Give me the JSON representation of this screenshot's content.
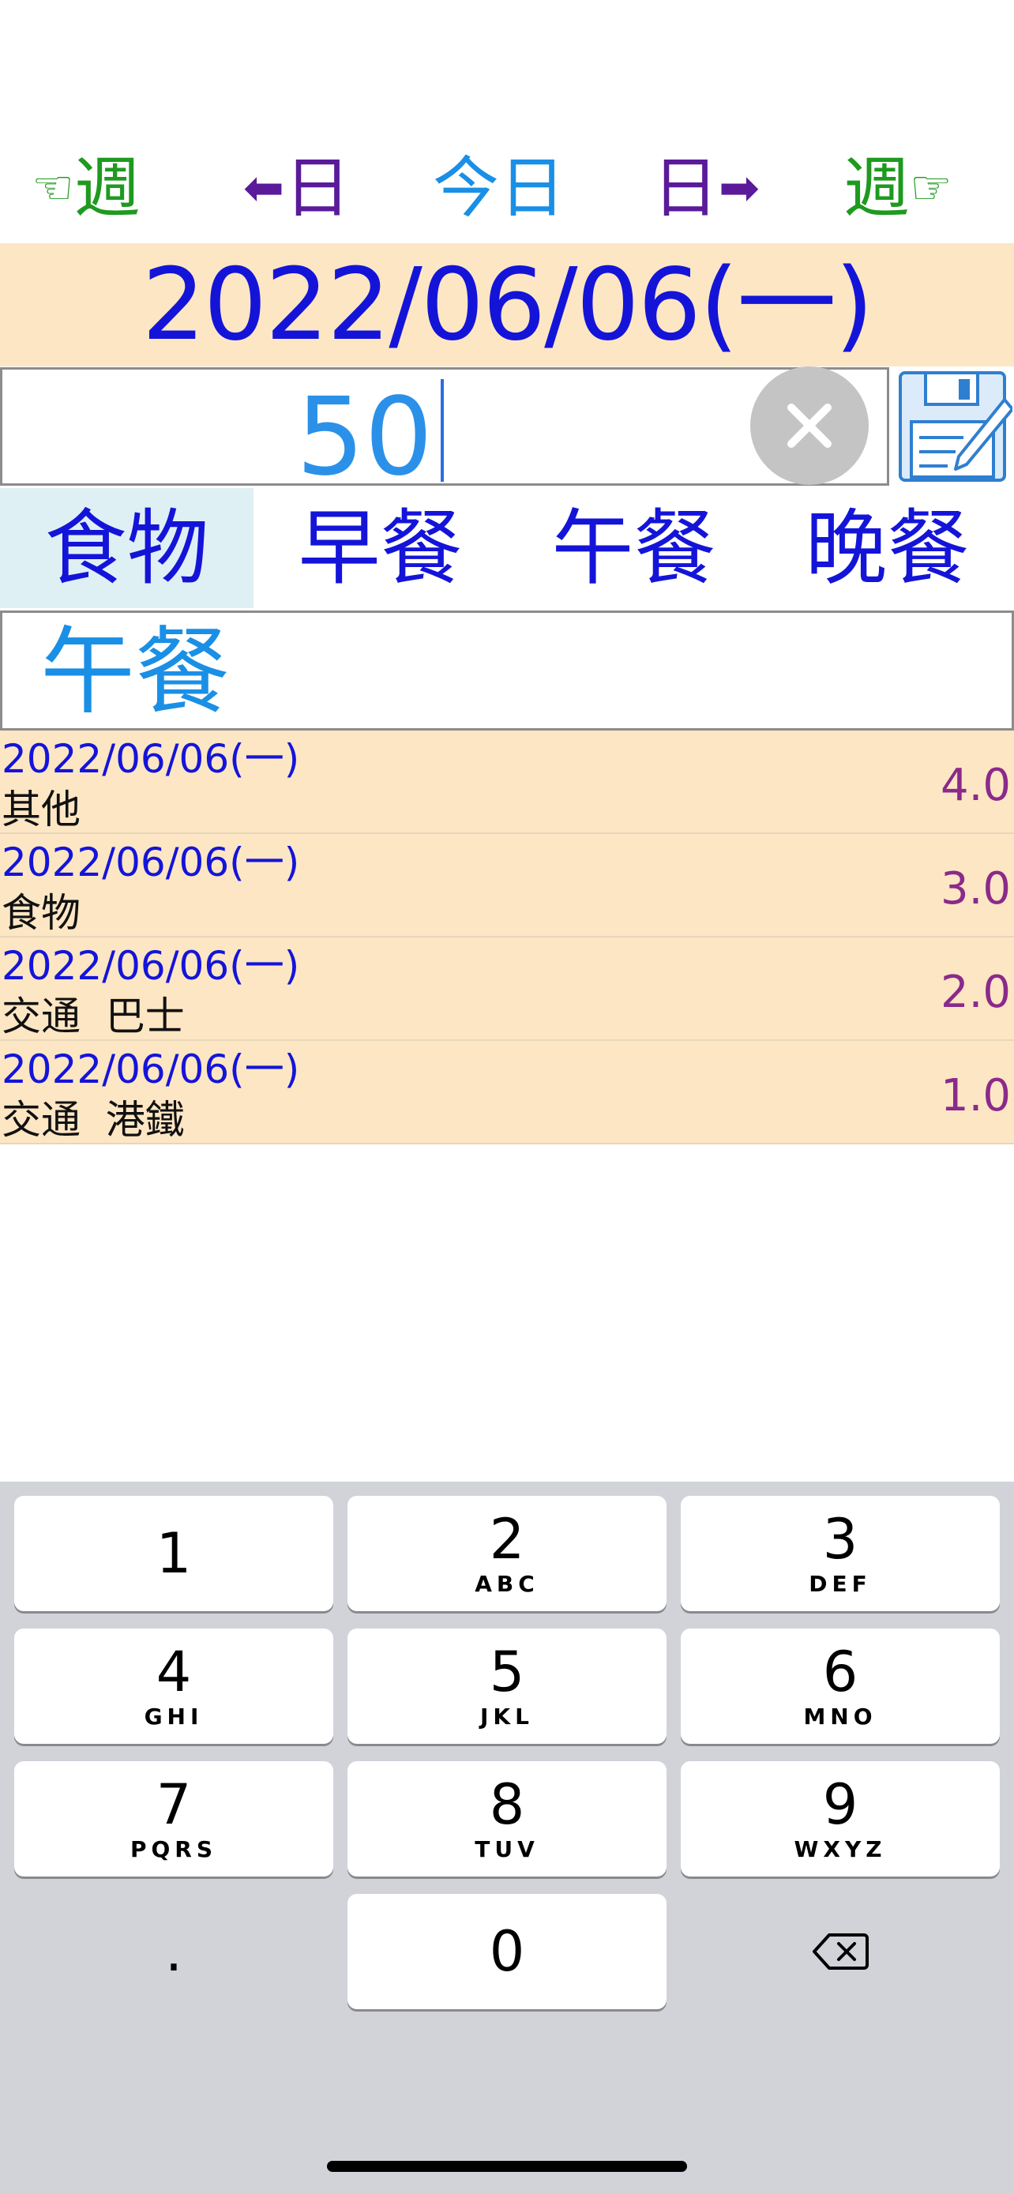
{
  "nav": {
    "week_prev": {
      "icon": "pointing-left-hand-icon",
      "glyph": "☜",
      "label": "週"
    },
    "day_prev": {
      "icon": "arrow-left-icon",
      "glyph": "⬅",
      "label": "日"
    },
    "today": {
      "label": "今日"
    },
    "day_next": {
      "icon": "arrow-right-icon",
      "glyph": "➡",
      "label": "日"
    },
    "week_next": {
      "icon": "pointing-right-hand-icon",
      "glyph": "☞",
      "label": "週"
    }
  },
  "date": "2022/06/06(一)",
  "amount": {
    "value": "50"
  },
  "tabs": [
    {
      "label": "食物",
      "active": true
    },
    {
      "label": "早餐",
      "active": false
    },
    {
      "label": "午餐",
      "active": false
    },
    {
      "label": "晚餐",
      "active": false
    }
  ],
  "description": "午餐",
  "records": [
    {
      "date": "2022/06/06(一)",
      "desc": "其他",
      "amount": "4.0"
    },
    {
      "date": "2022/06/06(一)",
      "desc": "食物",
      "amount": "3.0"
    },
    {
      "date": "2022/06/06(一)",
      "desc": "交通  巴士",
      "amount": "2.0"
    },
    {
      "date": "2022/06/06(一)",
      "desc": "交通  港鐵",
      "amount": "1.0"
    }
  ],
  "keyboard": {
    "keys": [
      {
        "num": "1",
        "letters": ""
      },
      {
        "num": "2",
        "letters": "ABC"
      },
      {
        "num": "3",
        "letters": "DEF"
      },
      {
        "num": "4",
        "letters": "GHI"
      },
      {
        "num": "5",
        "letters": "JKL"
      },
      {
        "num": "6",
        "letters": "MNO"
      },
      {
        "num": "7",
        "letters": "PQRS"
      },
      {
        "num": "8",
        "letters": "TUV"
      },
      {
        "num": "9",
        "letters": "WXYZ"
      },
      {
        "num": "0",
        "letters": ""
      }
    ],
    "dot": ".",
    "delete_icon": "backspace-icon"
  },
  "colors": {
    "nav_week": "#1e9a1e",
    "nav_day": "#5a1a99",
    "nav_today": "#1a8fe6",
    "banner_bg": "#fde6c4",
    "date_text": "#1414d9",
    "amount_text": "#2b91e8",
    "record_amount": "#8a2a8a",
    "keyboard_bg": "#d1d3d9"
  }
}
